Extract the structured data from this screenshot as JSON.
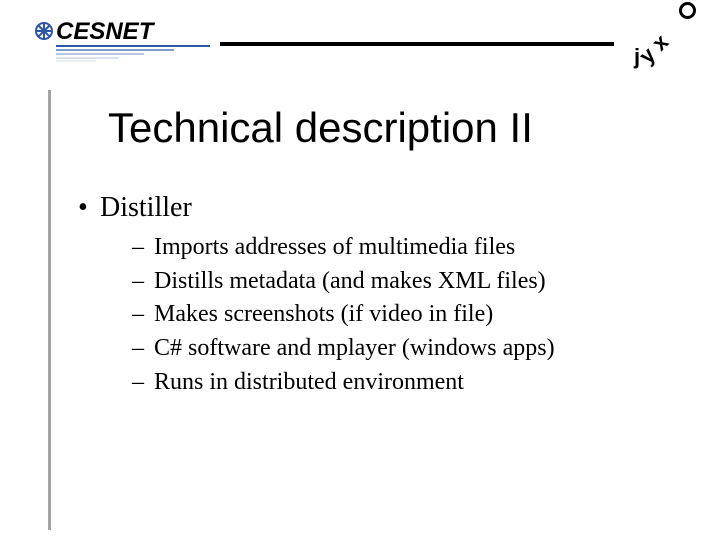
{
  "header": {
    "logo_left_text": "CESNET",
    "logo_right_hint": "jyxo"
  },
  "title": "Technical description II",
  "body": {
    "items": [
      {
        "label": "Distiller",
        "children": [
          "Imports addresses of multimedia files",
          "Distills metadata (and makes XML files)",
          "Makes screenshots (if video in file)",
          "C# software and mplayer (windows apps)",
          "Runs in distributed environment"
        ]
      }
    ]
  }
}
